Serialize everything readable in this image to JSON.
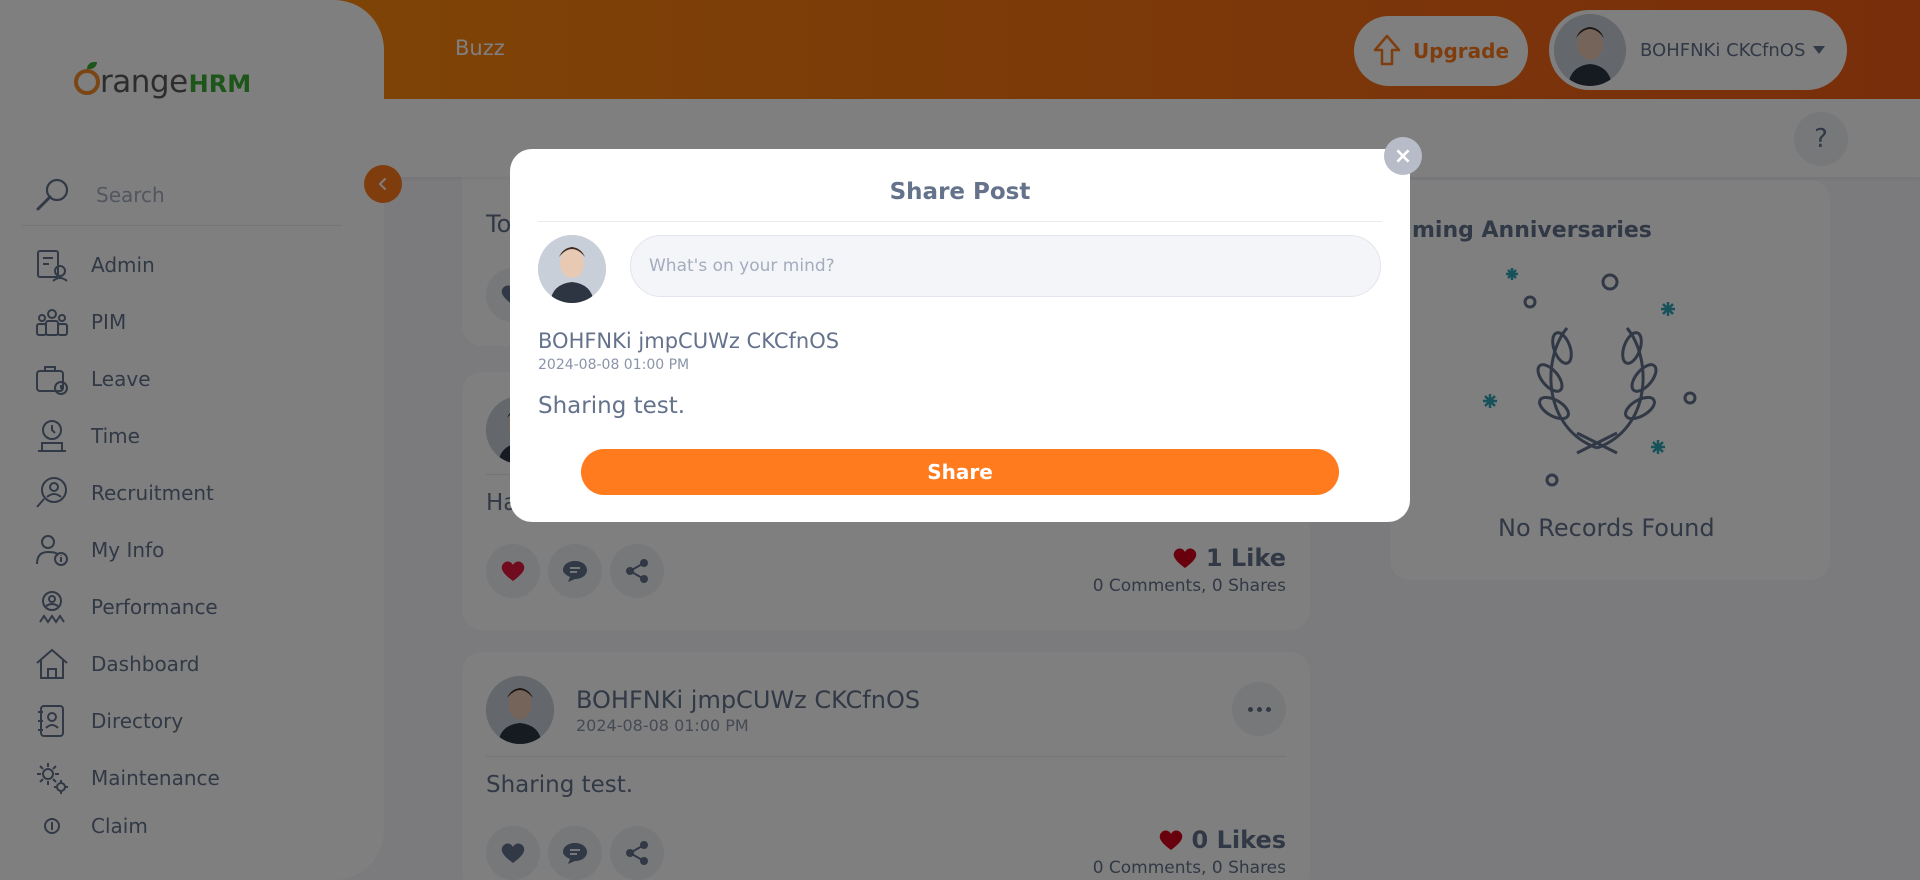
{
  "colors": {
    "brand_orange": "#ff7b1d",
    "header_gradient_start": "#ff920b",
    "header_gradient_end": "#f35c17",
    "text_primary": "#64728c",
    "like_red": "#d0021b",
    "logo_green": "#3aaa35"
  },
  "logo": {
    "part1": "range",
    "part2": "HRM"
  },
  "sidebar": {
    "search_placeholder": "Search",
    "items": [
      {
        "label": "Admin",
        "icon": "admin-icon"
      },
      {
        "label": "PIM",
        "icon": "pim-icon"
      },
      {
        "label": "Leave",
        "icon": "leave-icon"
      },
      {
        "label": "Time",
        "icon": "time-icon"
      },
      {
        "label": "Recruitment",
        "icon": "recruitment-icon"
      },
      {
        "label": "My Info",
        "icon": "my-info-icon"
      },
      {
        "label": "Performance",
        "icon": "performance-icon"
      },
      {
        "label": "Dashboard",
        "icon": "dashboard-icon"
      },
      {
        "label": "Directory",
        "icon": "directory-icon"
      },
      {
        "label": "Maintenance",
        "icon": "maintenance-icon"
      },
      {
        "label": "Claim",
        "icon": "claim-icon"
      }
    ]
  },
  "header": {
    "module_title": "Buzz",
    "upgrade_label": "Upgrade",
    "user_name": "BOHFNKi CKCfnOS",
    "help_label": "?"
  },
  "feed": {
    "card1_text": "To",
    "card2": {
      "body_partial": "Ha",
      "likes": "1 Like",
      "comments_shares": "0 Comments, 0 Shares"
    },
    "card3": {
      "author": "BOHFNKi jmpCUWz CKCfnOS",
      "date": "2024-08-08 01:00 PM",
      "body": "Sharing test.",
      "likes": "0 Likes",
      "comments_shares": "0 Comments, 0 Shares"
    }
  },
  "anniversaries": {
    "title": "ming Anniversaries",
    "empty_text": "No Records Found"
  },
  "modal": {
    "title": "Share Post",
    "close_label": "×",
    "input_placeholder": "What's on your mind?",
    "post_author": "BOHFNKi jmpCUWz CKCfnOS",
    "post_date": "2024-08-08 01:00 PM",
    "post_text": "Sharing test.",
    "share_label": "Share"
  }
}
